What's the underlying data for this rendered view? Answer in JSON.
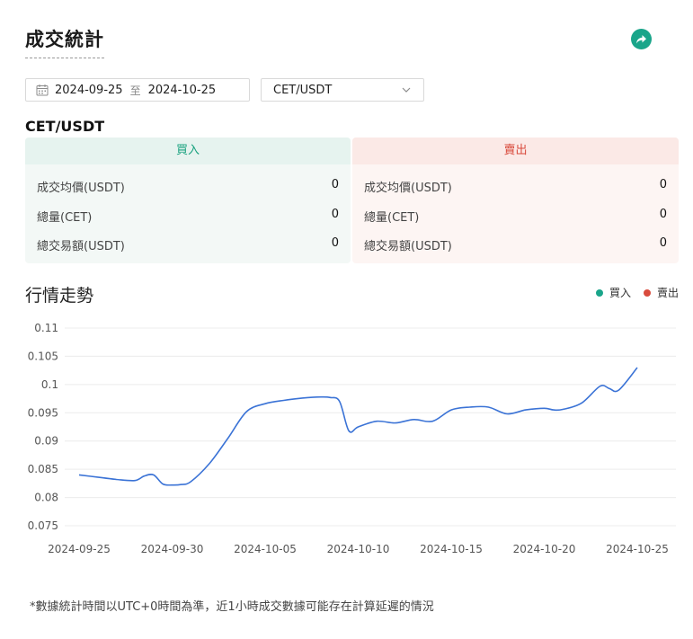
{
  "header": {
    "title": "成交統計",
    "share_icon": "share-arrow-icon"
  },
  "filters": {
    "date_from": "2024-09-25",
    "date_separator": "至",
    "date_to": "2024-10-25",
    "pair": "CET/USDT"
  },
  "pair_heading": "CET/USDT",
  "buy": {
    "title": "買入",
    "rows": [
      {
        "label": "成交均價(USDT)",
        "value": "0"
      },
      {
        "label": "總量(CET)",
        "value": "0"
      },
      {
        "label": "總交易額(USDT)",
        "value": "0"
      }
    ]
  },
  "sell": {
    "title": "賣出",
    "rows": [
      {
        "label": "成交均價(USDT)",
        "value": "0"
      },
      {
        "label": "總量(CET)",
        "value": "0"
      },
      {
        "label": "總交易額(USDT)",
        "value": "0"
      }
    ]
  },
  "trend": {
    "title": "行情走勢",
    "legend": [
      {
        "label": "買入",
        "color": "#1aa58a"
      },
      {
        "label": "賣出",
        "color": "#d94b3d"
      }
    ]
  },
  "chart_data": {
    "type": "line",
    "title": "",
    "xlabel": "",
    "ylabel": "",
    "ylim": [
      0.075,
      0.11
    ],
    "yticks": [
      "0.11",
      "0.105",
      "0.1",
      "0.095",
      "0.09",
      "0.085",
      "0.08",
      "0.075"
    ],
    "xticks": [
      "2024-09-25",
      "2024-09-30",
      "2024-10-05",
      "2024-10-10",
      "2024-10-15",
      "2024-10-20",
      "2024-10-25"
    ],
    "grid": true,
    "line_color": "#3b73d6",
    "series": [
      {
        "x": [
          "2024-09-25",
          "2024-09-26",
          "2024-09-27",
          "2024-09-28",
          "2024-09-28T12",
          "2024-09-29",
          "2024-09-29T12",
          "2024-09-30",
          "2024-09-30T12",
          "2024-10-01",
          "2024-10-02",
          "2024-10-03",
          "2024-10-04",
          "2024-10-05",
          "2024-10-06",
          "2024-10-07",
          "2024-10-08",
          "2024-10-08T12",
          "2024-10-09",
          "2024-10-09T12",
          "2024-10-10",
          "2024-10-11",
          "2024-10-12",
          "2024-10-13",
          "2024-10-14",
          "2024-10-15",
          "2024-10-16",
          "2024-10-17",
          "2024-10-18",
          "2024-10-19",
          "2024-10-20",
          "2024-10-20T12",
          "2024-10-21",
          "2024-10-22",
          "2024-10-23",
          "2024-10-23T12",
          "2024-10-24",
          "2024-10-25"
        ],
        "values": [
          0.084,
          0.0836,
          0.0832,
          0.083,
          0.0838,
          0.084,
          0.0824,
          0.0822,
          0.0823,
          0.0828,
          0.086,
          0.0905,
          0.0952,
          0.0966,
          0.0972,
          0.0976,
          0.0978,
          0.0977,
          0.097,
          0.0918,
          0.0925,
          0.0935,
          0.0932,
          0.0938,
          0.0935,
          0.0955,
          0.096,
          0.096,
          0.0948,
          0.0955,
          0.0958,
          0.0955,
          0.0956,
          0.0967,
          0.0997,
          0.0993,
          0.099,
          0.103
        ]
      }
    ]
  },
  "footnote": "*數據統計時間以UTC+0時間為準，近1小時成交數據可能存在計算延遲的情況"
}
